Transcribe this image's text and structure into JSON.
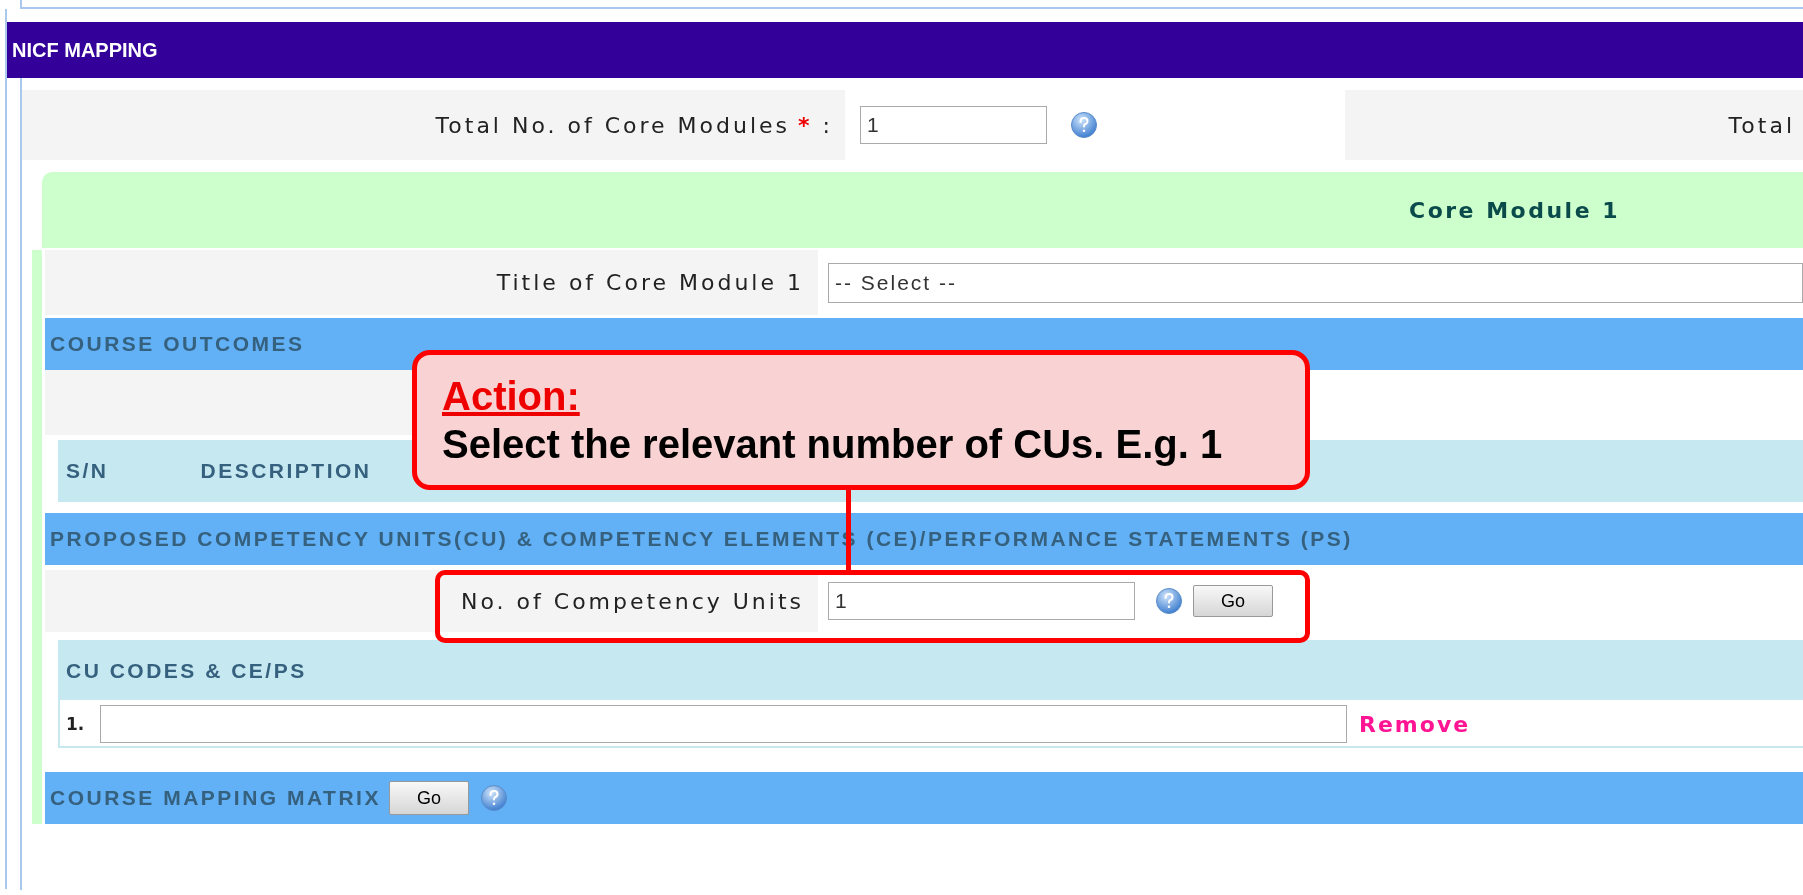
{
  "header": {
    "title": "NICF MAPPING"
  },
  "core_modules": {
    "label": "Total No. of Core Modules",
    "required": "*",
    "colon": ":",
    "value": "1",
    "next_label": "Total"
  },
  "core_module": {
    "title": "Core Module 1",
    "title_label": "Title of Core Module 1",
    "title_select": "-- Select --",
    "course_outcomes": {
      "heading": "COURSE OUTCOMES",
      "columns": [
        "S/N",
        "DESCRIPTION"
      ]
    },
    "competency": {
      "heading": "PROPOSED COMPETENCY UNITS(CU) & COMPETENCY ELEMENTS (CE)/PERFORMANCE STATEMENTS (PS)",
      "label": "No. of Competency Units",
      "value": "1",
      "button": "Go"
    },
    "cu_codes": {
      "heading": "CU CODES & CE/PS",
      "rows": [
        {
          "number": "1.",
          "action": "Remove"
        }
      ]
    },
    "mapping": {
      "heading": "COURSE MAPPING MATRIX",
      "button": "Go"
    }
  },
  "callout": {
    "heading": "Action:",
    "text": "Select the relevant number of CUs. E.g. 1"
  }
}
